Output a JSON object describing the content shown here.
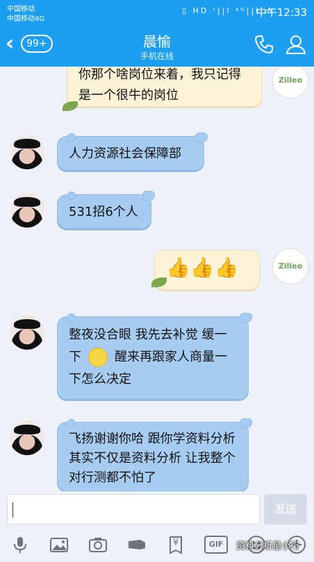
{
  "status_bar": {
    "carrier_primary": "中国移动",
    "carrier_secondary": "中国移动4G",
    "icons": "▯ HD ᵗ||l ⁴ᴳ||l ▭",
    "time": "中午12:33"
  },
  "header": {
    "unread_badge": "99+",
    "contact_name": "晨愉",
    "contact_status": "手机在线"
  },
  "messages": [
    {
      "side": "out",
      "text": "你那个啥岗位来着，我只记得是一个很牛的岗位"
    },
    {
      "side": "in",
      "text": "人力资源社会保障部"
    },
    {
      "side": "in",
      "text": "531招6个人"
    },
    {
      "side": "out",
      "text": "👍👍👍"
    },
    {
      "side": "in",
      "text_before_emoji": "整夜没合眼 我先去补觉 缓一下",
      "text_after_emoji": "醒来再跟家人商量一下怎么决定"
    },
    {
      "side": "in",
      "text": "飞扬谢谢你哈 跟你学资料分析其实不仅是资料分析 让我整个对行测都不怕了"
    }
  ],
  "self_avatar_text": "Zilleo",
  "composer": {
    "placeholder": "",
    "send_label": "发送"
  },
  "toolbar_icons": [
    "microphone-icon",
    "image-icon",
    "camera-icon",
    "red-packet-icon",
    "yuan-icon",
    "gif-icon",
    "emoji-icon",
    "plus-icon"
  ],
  "toolbar_labels": {
    "gif": "GIF",
    "yuan": "¥"
  },
  "watermark": "资料分析星小行"
}
